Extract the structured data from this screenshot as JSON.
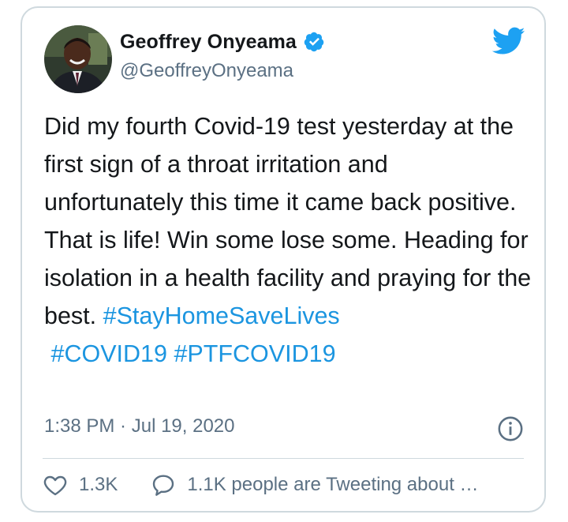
{
  "author": {
    "name": "Geoffrey Onyeama",
    "handle": "@GeoffreyOnyeama"
  },
  "tweet": {
    "text": "Did my fourth Covid-19 test yesterday at the first sign of a throat irritation and unfortunately this time it came back positive. That is life! Win some lose some. Heading for isolation in a health facility and praying for the best. ",
    "hashtags": [
      "#StayHomeSaveLives",
      "#COVID19",
      "#PTFCOVID19"
    ]
  },
  "meta": {
    "time": "1:38 PM",
    "separator": " · ",
    "date": "Jul 19, 2020"
  },
  "actions": {
    "likes": "1.3K",
    "reply_text": "1.1K people are Tweeting about this"
  },
  "colors": {
    "accent": "#1b95e0",
    "text": "#14171a",
    "muted": "#5b7083",
    "border": "#cfd9de"
  },
  "icons": [
    "verified-badge-icon",
    "twitter-bird-icon",
    "info-icon",
    "heart-icon",
    "speech-bubble-icon"
  ]
}
